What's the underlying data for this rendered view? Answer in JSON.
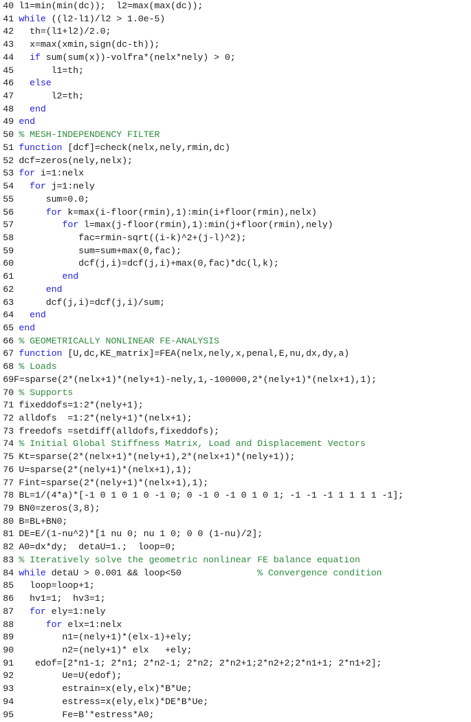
{
  "listing": {
    "language": "MATLAB",
    "first_line_number": 40,
    "last_line_number": 95,
    "colors": {
      "background": "#ffffff",
      "plain_text": "#1a1a1a",
      "keyword": "#2222dd",
      "comment": "#2e8b3e"
    },
    "lines": [
      {
        "num": "40",
        "tight": false,
        "tokens": [
          {
            "t": "plain",
            "s": "l1=min(min(dc));  l2=max(max(dc));"
          }
        ]
      },
      {
        "num": "41",
        "tight": false,
        "tokens": [
          {
            "t": "kw",
            "s": "while"
          },
          {
            "t": "plain",
            "s": " ((l2-l1)/l2 > 1.0e-5)"
          }
        ]
      },
      {
        "num": "42",
        "tight": false,
        "tokens": [
          {
            "t": "plain",
            "s": "  th=(l1+l2)/2.0;"
          }
        ]
      },
      {
        "num": "43",
        "tight": false,
        "tokens": [
          {
            "t": "plain",
            "s": "  x=max(xmin,sign(dc-th));"
          }
        ]
      },
      {
        "num": "44",
        "tight": false,
        "tokens": [
          {
            "t": "plain",
            "s": "  "
          },
          {
            "t": "kw",
            "s": "if"
          },
          {
            "t": "plain",
            "s": " sum(sum(x))-volfra*(nelx*nely) > 0;"
          }
        ]
      },
      {
        "num": "45",
        "tight": false,
        "tokens": [
          {
            "t": "plain",
            "s": "      l1=th;"
          }
        ]
      },
      {
        "num": "46",
        "tight": false,
        "tokens": [
          {
            "t": "plain",
            "s": "  "
          },
          {
            "t": "kw",
            "s": "else"
          }
        ]
      },
      {
        "num": "47",
        "tight": false,
        "tokens": [
          {
            "t": "plain",
            "s": "      l2=th;"
          }
        ]
      },
      {
        "num": "48",
        "tight": false,
        "tokens": [
          {
            "t": "plain",
            "s": "  "
          },
          {
            "t": "kw",
            "s": "end"
          }
        ]
      },
      {
        "num": "49",
        "tight": false,
        "tokens": [
          {
            "t": "kw",
            "s": "end"
          }
        ]
      },
      {
        "num": "50",
        "tight": false,
        "tokens": [
          {
            "t": "cmt",
            "s": "% MESH-INDEPENDENCY FILTER"
          }
        ]
      },
      {
        "num": "51",
        "tight": false,
        "tokens": [
          {
            "t": "kw",
            "s": "function"
          },
          {
            "t": "plain",
            "s": " [dcf]=check(nelx,nely,rmin,dc)"
          }
        ]
      },
      {
        "num": "52",
        "tight": false,
        "tokens": [
          {
            "t": "plain",
            "s": "dcf=zeros(nely,nelx);"
          }
        ]
      },
      {
        "num": "53",
        "tight": false,
        "tokens": [
          {
            "t": "kw",
            "s": "for"
          },
          {
            "t": "plain",
            "s": " i=1:nelx"
          }
        ]
      },
      {
        "num": "54",
        "tight": false,
        "tokens": [
          {
            "t": "plain",
            "s": "  "
          },
          {
            "t": "kw",
            "s": "for"
          },
          {
            "t": "plain",
            "s": " j=1:nely"
          }
        ]
      },
      {
        "num": "55",
        "tight": false,
        "tokens": [
          {
            "t": "plain",
            "s": "     sum=0.0;"
          }
        ]
      },
      {
        "num": "56",
        "tight": false,
        "tokens": [
          {
            "t": "plain",
            "s": "     "
          },
          {
            "t": "kw",
            "s": "for"
          },
          {
            "t": "plain",
            "s": " k=max(i-floor(rmin),1):min(i+floor(rmin),nelx)"
          }
        ]
      },
      {
        "num": "57",
        "tight": false,
        "tokens": [
          {
            "t": "plain",
            "s": "        "
          },
          {
            "t": "kw",
            "s": "for"
          },
          {
            "t": "plain",
            "s": " l=max(j-floor(rmin),1):min(j+floor(rmin),nely)"
          }
        ]
      },
      {
        "num": "58",
        "tight": false,
        "tokens": [
          {
            "t": "plain",
            "s": "           fac=rmin-sqrt((i-k)^2+(j-l)^2);"
          }
        ]
      },
      {
        "num": "59",
        "tight": false,
        "tokens": [
          {
            "t": "plain",
            "s": "           sum=sum+max(0,fac);"
          }
        ]
      },
      {
        "num": "60",
        "tight": false,
        "tokens": [
          {
            "t": "plain",
            "s": "           dcf(j,i)=dcf(j,i)+max(0,fac)*dc(l,k);"
          }
        ]
      },
      {
        "num": "61",
        "tight": false,
        "tokens": [
          {
            "t": "plain",
            "s": "        "
          },
          {
            "t": "kw",
            "s": "end"
          }
        ]
      },
      {
        "num": "62",
        "tight": false,
        "tokens": [
          {
            "t": "plain",
            "s": "     "
          },
          {
            "t": "kw",
            "s": "end"
          }
        ]
      },
      {
        "num": "63",
        "tight": false,
        "tokens": [
          {
            "t": "plain",
            "s": "     dcf(j,i)=dcf(j,i)/sum;"
          }
        ]
      },
      {
        "num": "64",
        "tight": false,
        "tokens": [
          {
            "t": "plain",
            "s": "  "
          },
          {
            "t": "kw",
            "s": "end"
          }
        ]
      },
      {
        "num": "65",
        "tight": false,
        "tokens": [
          {
            "t": "kw",
            "s": "end"
          }
        ]
      },
      {
        "num": "66",
        "tight": false,
        "tokens": [
          {
            "t": "cmt",
            "s": "% GEOMETRICALLY NONLINEAR FE-ANALYSIS"
          }
        ]
      },
      {
        "num": "67",
        "tight": false,
        "tokens": [
          {
            "t": "kw",
            "s": "function"
          },
          {
            "t": "plain",
            "s": " [U,dc,KE_matrix]=FEA(nelx,nely,x,penal,E,nu,dx,dy,a)"
          }
        ]
      },
      {
        "num": "68",
        "tight": false,
        "tokens": [
          {
            "t": "cmt",
            "s": "% Loads"
          }
        ]
      },
      {
        "num": "69",
        "tight": true,
        "tokens": [
          {
            "t": "plain",
            "s": "F=sparse(2*(nelx+1)*(nely+1)-nely,1,-100000,2*(nely+1)*(nelx+1),1);"
          }
        ]
      },
      {
        "num": "70",
        "tight": false,
        "tokens": [
          {
            "t": "cmt",
            "s": "% Supports"
          }
        ]
      },
      {
        "num": "71",
        "tight": false,
        "tokens": [
          {
            "t": "plain",
            "s": "fixeddofs=1:2*(nely+1);"
          }
        ]
      },
      {
        "num": "72",
        "tight": false,
        "tokens": [
          {
            "t": "plain",
            "s": "alldofs  =1:2*(nely+1)*(nelx+1);"
          }
        ]
      },
      {
        "num": "73",
        "tight": false,
        "tokens": [
          {
            "t": "plain",
            "s": "freedofs =setdiff(alldofs,fixeddofs);"
          }
        ]
      },
      {
        "num": "74",
        "tight": false,
        "tokens": [
          {
            "t": "cmt",
            "s": "% Initial Global Stiffness Matrix, Load and Displacement Vectors"
          }
        ]
      },
      {
        "num": "75",
        "tight": false,
        "tokens": [
          {
            "t": "plain",
            "s": "Kt=sparse(2*(nelx+1)*(nely+1),2*(nelx+1)*(nely+1));"
          }
        ]
      },
      {
        "num": "76",
        "tight": false,
        "tokens": [
          {
            "t": "plain",
            "s": "U=sparse(2*(nely+1)*(nelx+1),1);"
          }
        ]
      },
      {
        "num": "77",
        "tight": false,
        "tokens": [
          {
            "t": "plain",
            "s": "Fint=sparse(2*(nely+1)*(nelx+1),1);"
          }
        ]
      },
      {
        "num": "78",
        "tight": false,
        "tokens": [
          {
            "t": "plain",
            "s": "BL=1/(4*a)*[-1 0 1 0 1 0 -1 0; 0 -1 0 -1 0 1 0 1; -1 -1 -1 1 1 1 1 -1];"
          }
        ]
      },
      {
        "num": "79",
        "tight": false,
        "tokens": [
          {
            "t": "plain",
            "s": "BN0=zeros(3,8);"
          }
        ]
      },
      {
        "num": "80",
        "tight": false,
        "tokens": [
          {
            "t": "plain",
            "s": "B=BL+BN0;"
          }
        ]
      },
      {
        "num": "81",
        "tight": false,
        "tokens": [
          {
            "t": "plain",
            "s": "DE=E/(1-nu^2)*[1 nu 0; nu 1 0; 0 0 (1-nu)/2];"
          }
        ]
      },
      {
        "num": "82",
        "tight": false,
        "tokens": [
          {
            "t": "plain",
            "s": "A0=dx*dy;  detaU=1.;  loop=0;"
          }
        ]
      },
      {
        "num": "83",
        "tight": false,
        "tokens": [
          {
            "t": "cmt",
            "s": "% Iteratively solve the geometric nonlinear FE balance equation"
          }
        ]
      },
      {
        "num": "84",
        "tight": false,
        "tokens": [
          {
            "t": "kw",
            "s": "while"
          },
          {
            "t": "plain",
            "s": " detaU > 0.001 && loop<50              "
          },
          {
            "t": "cmt",
            "s": "% Convergence condition"
          }
        ]
      },
      {
        "num": "85",
        "tight": false,
        "tokens": [
          {
            "t": "plain",
            "s": "  loop=loop+1;"
          }
        ]
      },
      {
        "num": "86",
        "tight": false,
        "tokens": [
          {
            "t": "plain",
            "s": "  hv1=1;  hv3=1;"
          }
        ]
      },
      {
        "num": "87",
        "tight": false,
        "tokens": [
          {
            "t": "plain",
            "s": "  "
          },
          {
            "t": "kw",
            "s": "for"
          },
          {
            "t": "plain",
            "s": " ely=1:nely"
          }
        ]
      },
      {
        "num": "88",
        "tight": false,
        "tokens": [
          {
            "t": "plain",
            "s": "     "
          },
          {
            "t": "kw",
            "s": "for"
          },
          {
            "t": "plain",
            "s": " elx=1:nelx"
          }
        ]
      },
      {
        "num": "89",
        "tight": false,
        "tokens": [
          {
            "t": "plain",
            "s": "        n1=(nely+1)*(elx-1)+ely;"
          }
        ]
      },
      {
        "num": "90",
        "tight": false,
        "tokens": [
          {
            "t": "plain",
            "s": "        n2=(nely+1)* elx   +ely;"
          }
        ]
      },
      {
        "num": "91",
        "tight": false,
        "tokens": [
          {
            "t": "plain",
            "s": "   edof=[2*n1-1; 2*n1; 2*n2-1; 2*n2; 2*n2+1;2*n2+2;2*n1+1; 2*n1+2];"
          }
        ]
      },
      {
        "num": "92",
        "tight": false,
        "tokens": [
          {
            "t": "plain",
            "s": "        Ue=U(edof);"
          }
        ]
      },
      {
        "num": "93",
        "tight": false,
        "tokens": [
          {
            "t": "plain",
            "s": "        estrain=x(ely,elx)*B*Ue;"
          }
        ]
      },
      {
        "num": "94",
        "tight": false,
        "tokens": [
          {
            "t": "plain",
            "s": "        estress=x(ely,elx)*DE*B*Ue;"
          }
        ]
      },
      {
        "num": "95",
        "tight": false,
        "tokens": [
          {
            "t": "plain",
            "s": "        Fe=B'*estress*A0;"
          }
        ]
      }
    ]
  }
}
